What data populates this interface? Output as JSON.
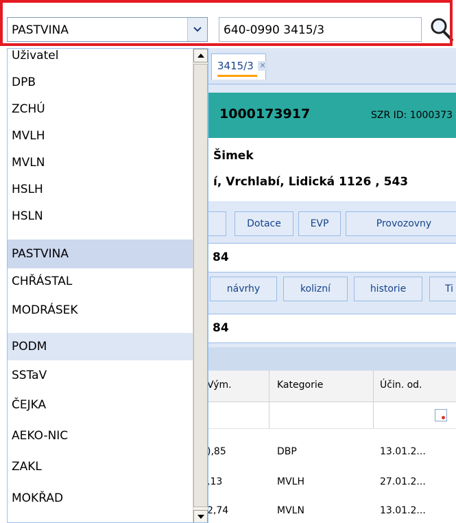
{
  "toolbar": {
    "layer_combo_value": "PASTVINA",
    "search_value": "640-0990 3415/3"
  },
  "dropdown": {
    "items": [
      "Uživatel",
      "DPB",
      "ZCHÚ",
      "MVLH",
      "MVLN",
      "HSLH",
      "HSLN",
      "PASTVINA",
      "CHŘÁSTAL",
      "MODRÁSEK",
      "PODM",
      "SSTaV",
      "ČEJKA",
      "AEKO-NIC",
      "ZAKL",
      "MOKŘAD"
    ],
    "selected": "PASTVINA",
    "hovered": "PODM"
  },
  "document_tab": {
    "label": "3415/3"
  },
  "header": {
    "id": "1000173917",
    "szr": "SZR ID: 1000373",
    "name": "Šimek",
    "address": "í, Vrchlabí, Lidická 1126 , 543"
  },
  "buttons": [
    "Dotace",
    "EVP",
    "Provozovny"
  ],
  "bar1_value": "84",
  "subtabs": [
    "návrhy",
    "kolizní",
    "historie",
    "Ti"
  ],
  "bar2_value": "84",
  "grid": {
    "columns": [
      "Vým.",
      "Kategorie",
      "Účin. od."
    ],
    "rows": [
      [
        "),85",
        "DBP",
        "13.01.2..."
      ],
      [
        ",13",
        "MVLH",
        "27.01.2..."
      ],
      [
        "2,74",
        "MVLN",
        "13.01.2..."
      ]
    ]
  },
  "colors": {
    "highlight": "#e41b23",
    "teal": "#2aa9a0",
    "selected_row": "#ccd8ee"
  }
}
